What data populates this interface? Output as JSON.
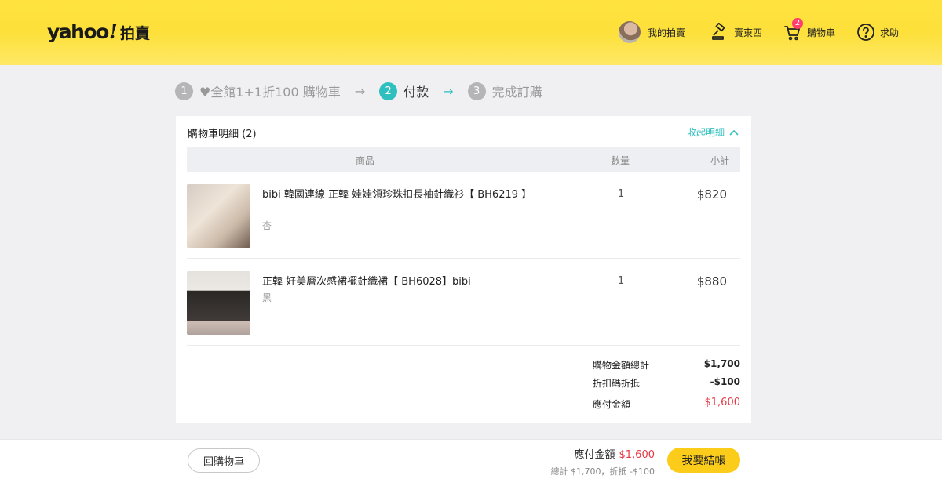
{
  "header": {
    "logo_word": "yahoo",
    "logo_bang": "!",
    "logo_sub": "拍賣",
    "nav": {
      "my_auction": "我的拍賣",
      "sell": "賣東西",
      "cart": "購物車",
      "cart_count": "2",
      "help": "求助"
    }
  },
  "steps": [
    {
      "num": "1",
      "label": "♥全館1+1折100 購物車"
    },
    {
      "num": "2",
      "label": "付款"
    },
    {
      "num": "3",
      "label": "完成訂購"
    }
  ],
  "arrows": [
    "→",
    "→"
  ],
  "cart": {
    "title": "購物車明細 (2)",
    "collapse_label": "收起明細",
    "columns": {
      "product": "商品",
      "qty": "數量",
      "subtotal": "小計"
    },
    "items": [
      {
        "name": "bibi 韓國連線 正韓 娃娃領珍珠扣長袖針織衫【 BH6219 】",
        "variant": "杏",
        "qty": "1",
        "price": "$820"
      },
      {
        "name": "正韓 好美層次感裙襬針織裙【 BH6028】bibi",
        "variant": "黑",
        "qty": "1",
        "price": "$880"
      }
    ],
    "summary": {
      "total_label": "購物金額總計",
      "total_value": "$1,700",
      "discount_label": "折扣碼折抵",
      "discount_value": "-$100",
      "due_label": "應付金額",
      "due_value": "$1,600"
    }
  },
  "footer": {
    "back_label": "回購物車",
    "due_label": "應付金額",
    "due_value": "$1,600",
    "breakdown": "總計 $1,700，折抵 -$100",
    "checkout_label": "我要結帳"
  },
  "colors": {
    "brand_yellow": "#fde03a",
    "accent_teal": "#2fbfbf",
    "price_red": "#e63946",
    "checkout_yellow": "#fccc1a"
  }
}
